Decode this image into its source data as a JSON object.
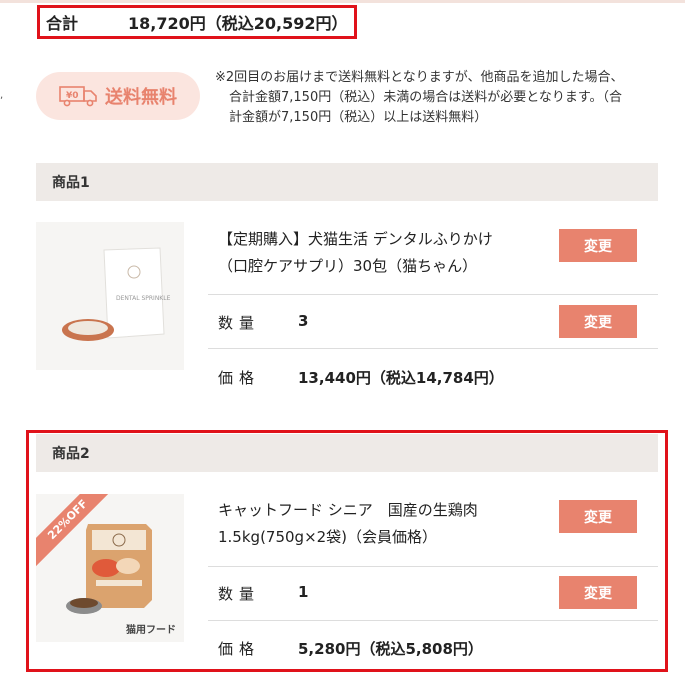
{
  "summary": {
    "total_label": "合計",
    "total_value": "18,720円（税込20,592円）"
  },
  "shipping": {
    "badge_text": "送料無料",
    "icon_text": "¥0",
    "note_lines": [
      "※2回目のお届けまで送料無料となりますが、他商品を追加した場合、",
      "合計金額7,150円（税込）未満の場合は送料が必要となります。（合",
      "計金額が7,150円（税込）以上は送料無料）"
    ]
  },
  "products": [
    {
      "header": "商品1",
      "name_line1": "【定期購入】犬猫生活 デンタルふりかけ",
      "name_line2": "（口腔ケアサプリ）30包（猫ちゃん）",
      "quantity_label": "数量",
      "quantity": "3",
      "price_label": "価格",
      "price": "13,440円（税込14,784円）",
      "change_label": "変更",
      "image_text": "DENTAL SPRINKLE"
    },
    {
      "header": "商品2",
      "name_line1": "キャットフード シニア　国産の生鶏肉",
      "name_line2": "1.5kg(750g×2袋)（会員価格）",
      "quantity_label": "数量",
      "quantity": "1",
      "price_label": "価格",
      "price": "5,280円（税込5,808円）",
      "change_label": "変更",
      "discount_ribbon": "22%OFF",
      "image_caption": "猫用フード"
    }
  ],
  "colors": {
    "accent": "#e8836e",
    "highlight": "#e0121a",
    "header_bg": "#eeeae7",
    "badge_bg": "#fbe5df"
  }
}
